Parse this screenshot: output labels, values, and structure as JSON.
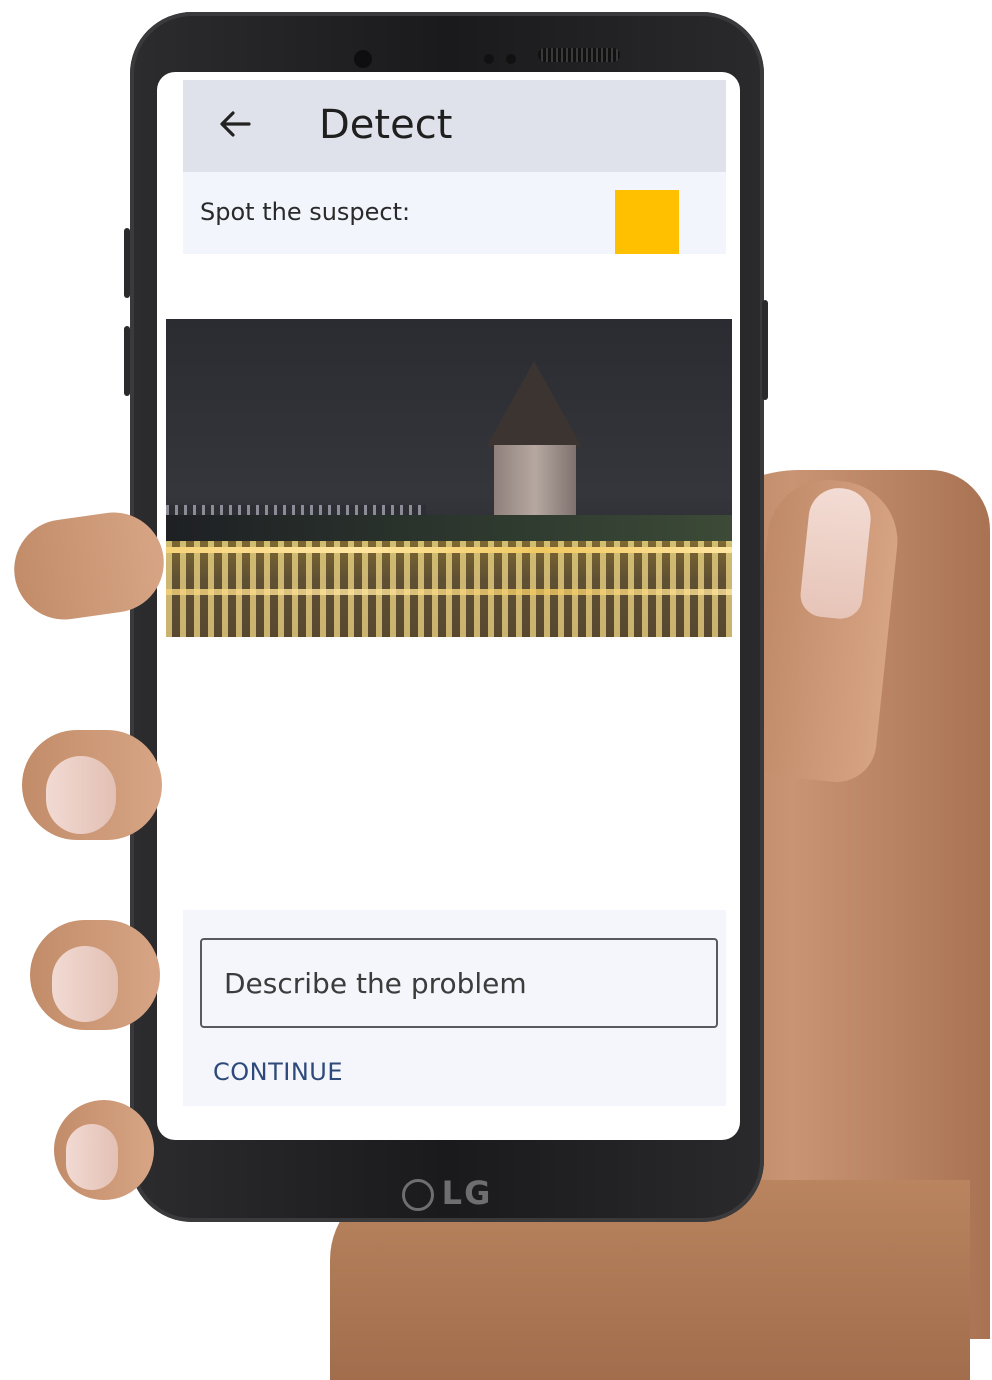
{
  "device": {
    "brand_label": "LG"
  },
  "app_bar": {
    "back_icon": "arrow-left-icon",
    "title": "Detect"
  },
  "prompt": {
    "text": "Spot the suspect:",
    "swatch_color": "#FFC000"
  },
  "photo": {
    "subject": "night river scene with illuminated bridge and stone tower"
  },
  "form": {
    "description_placeholder": "Describe the problem",
    "description_value": "",
    "continue_label": "CONTINUE"
  },
  "colors": {
    "app_bar_bg": "#DFE2EA",
    "panel_bg": "#F4F6FB",
    "accent_text": "#2D4A7A"
  }
}
